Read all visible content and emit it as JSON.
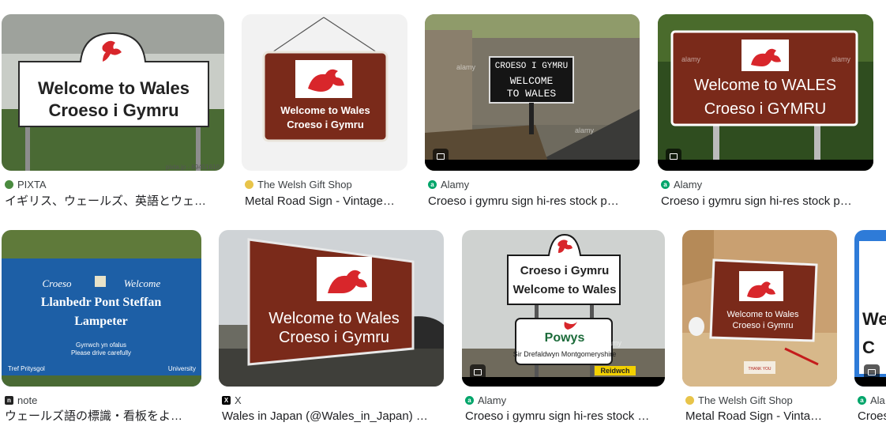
{
  "results": [
    {
      "source": "PIXTA",
      "title": "イギリス、ウェールズ、英語とウェ…",
      "sign_line1": "Welcome to Wales",
      "sign_line2": "Croeso i Gymru",
      "credit": "pixta.jp - 69451610"
    },
    {
      "source": "The Welsh Gift Shop",
      "title": "Metal Road Sign - Vintage…",
      "sign_line1": "Welcome to Wales",
      "sign_line2": "Croeso i Gymru"
    },
    {
      "source": "Alamy",
      "title": "Croeso i gymru sign hi-res stock p…",
      "sign_line1": "CROESO I GYMRU",
      "sign_line2": "WELCOME",
      "sign_line3": "TO WALES",
      "watermark": "alamy"
    },
    {
      "source": "Alamy",
      "title": "Croeso i gymru sign hi-res stock p…",
      "sign_line1": "Welcome to WALES",
      "sign_line2": "Croeso i GYMRU",
      "watermark": "alamy"
    },
    {
      "source": "note",
      "title": "ウェールズ語の標識・看板をよ…",
      "sign_top_left": "Croeso",
      "sign_top_right": "Welcome",
      "sign_line1": "Llanbedr Pont Steffan",
      "sign_line2": "Lampeter",
      "sign_small1": "Gyrrwch yn ofalus",
      "sign_small2": "Please drive carefully",
      "sign_foot_left": "Tref Pritysgol",
      "sign_foot_right": "University"
    },
    {
      "source": "X",
      "title": "Wales in Japan (@Wales_in_Japan) …",
      "sign_line1": "Welcome to Wales",
      "sign_line2": "Croeso i Gymru"
    },
    {
      "source": "Alamy",
      "title": "Croeso i gymru sign hi-res stock …",
      "sign_line1": "Croeso i Gymru",
      "sign_line2": "Welcome to Wales",
      "sign_line3": "Powys",
      "sign_line4": "Sir Drefaldwyn Montgomeryshire",
      "sign_line5": "Reidwch",
      "watermark": "alamy"
    },
    {
      "source": "The Welsh Gift Shop",
      "title": "Metal Road Sign - Vinta…",
      "sign_line1": "Welcome to Wales",
      "sign_line2": "Croeso i Gymru",
      "card_text": "THANK YOU"
    },
    {
      "source": "Ala",
      "title": "Croes",
      "sign_line1": "We",
      "sign_line2": "C"
    }
  ],
  "colors": {
    "welsh_brown": "#7a2a1a",
    "dragon_red": "#d8262b",
    "sign_blue": "#1d5fa6",
    "alamy_green": "#00a56a"
  }
}
